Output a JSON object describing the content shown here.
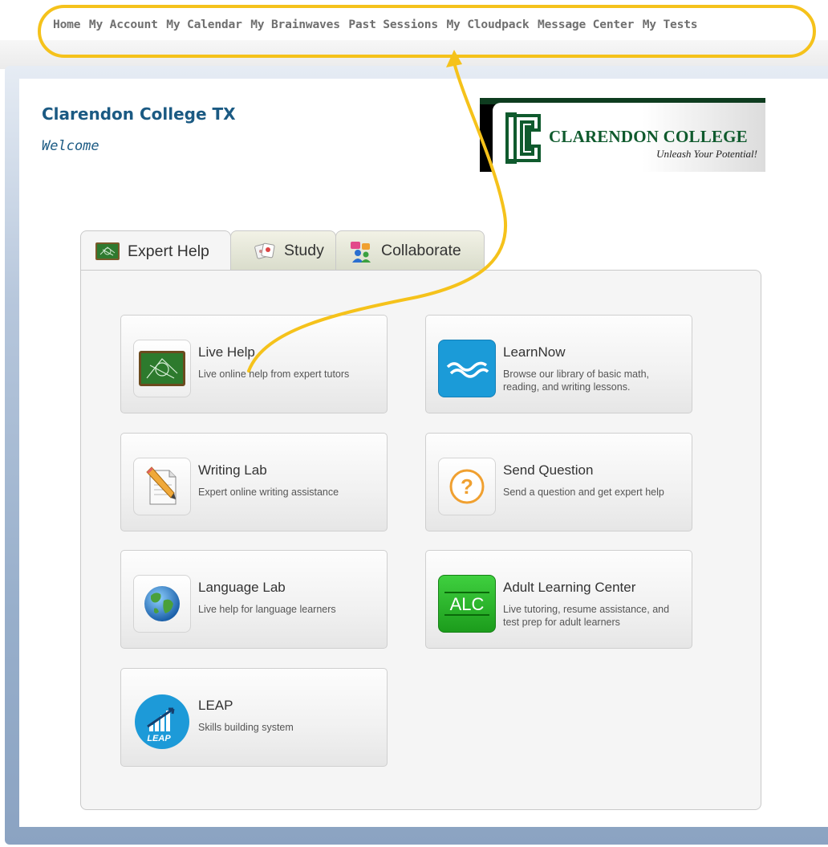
{
  "nav": {
    "items": [
      "Home",
      "My Account",
      "My Calendar",
      "My Brainwaves",
      "Past Sessions",
      "My Cloudpack",
      "Message Center",
      "My Tests"
    ]
  },
  "header": {
    "school_name": "Clarendon College TX",
    "welcome": "Welcome"
  },
  "logo": {
    "title": "CLARENDON COLLEGE",
    "tagline": "Unleash Your Potential!"
  },
  "tabs": [
    {
      "label": "Expert Help",
      "icon": "chalkboard-icon",
      "active": true
    },
    {
      "label": "Study",
      "icon": "flashcards-icon",
      "active": false
    },
    {
      "label": "Collaborate",
      "icon": "people-icon",
      "active": false
    }
  ],
  "services": [
    {
      "title": "Live Help",
      "desc": "Live online help from expert tutors",
      "icon": "chalkboard-icon"
    },
    {
      "title": "LearnNow",
      "desc": "Browse our library of basic math, reading, and writing lessons.",
      "icon": "wave-icon"
    },
    {
      "title": "Writing Lab",
      "desc": "Expert online writing assistance",
      "icon": "pencil-paper-icon"
    },
    {
      "title": "Send Question",
      "desc": "Send a question and get expert help",
      "icon": "question-icon"
    },
    {
      "title": "Language Lab",
      "desc": "Live help for language learners",
      "icon": "globe-icon"
    },
    {
      "title": "Adult Learning Center",
      "desc": "Live tutoring, resume assistance, and test prep for adult learners",
      "icon": "alc-icon",
      "icon_text": "ALC"
    },
    {
      "title": "LEAP",
      "desc": "Skills building system",
      "icon": "leap-icon",
      "icon_text": "LEAP"
    }
  ],
  "colors": {
    "highlight": "#f5c21b",
    "school_blue": "#1b5a83",
    "logo_green": "#0f5a2d"
  }
}
